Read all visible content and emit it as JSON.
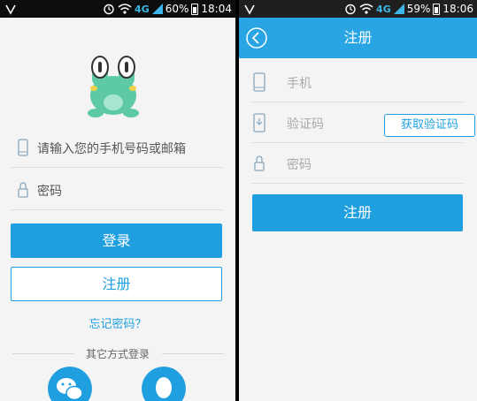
{
  "login_screen": {
    "status_bar": {
      "network": "4G",
      "battery_percent": "60%",
      "time": "18:04",
      "battery_level": 0.6
    },
    "account_placeholder": "请输入您的手机号码或邮箱",
    "password_placeholder": "密码",
    "login_label": "登录",
    "register_label": "注册",
    "forgot_label": "忘记密码？",
    "other_login_title": "其它方式登录",
    "social_icons": [
      "wechat-icon",
      "qq-icon"
    ]
  },
  "register_screen": {
    "status_bar": {
      "network": "4G",
      "battery_percent": "59%",
      "time": "18:06",
      "battery_level": 0.59
    },
    "title": "注册",
    "phone_placeholder": "手机",
    "code_placeholder": "验证码",
    "get_code_label": "获取验证码",
    "password_placeholder": "密码",
    "submit_label": "注册"
  },
  "colors": {
    "accent": "#1f9fe0",
    "titlebar": "#2aa5e4",
    "mascot_green": "#5ec9a5",
    "social_blue": "#1f9fe0"
  }
}
